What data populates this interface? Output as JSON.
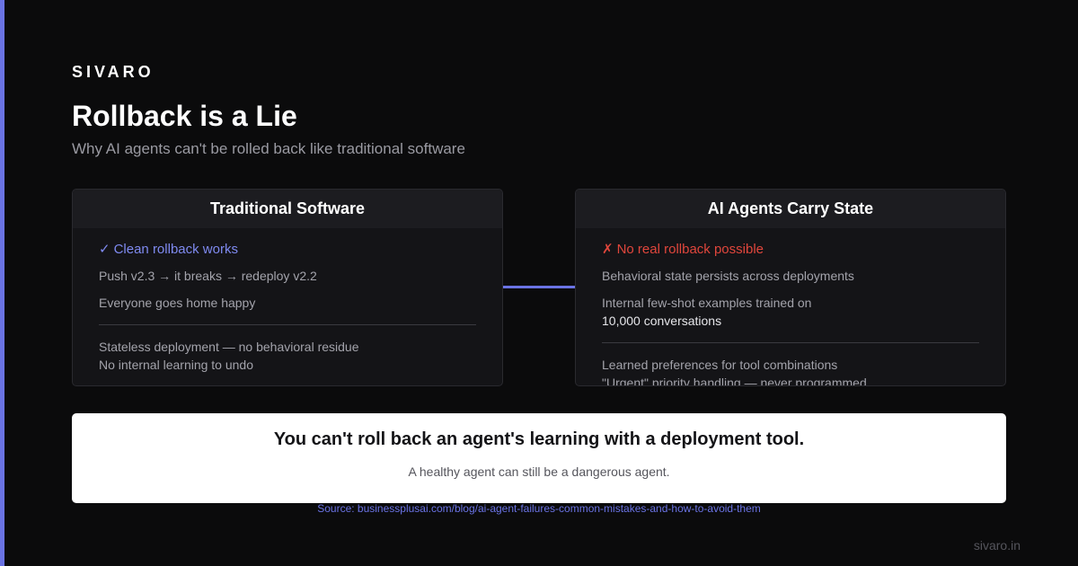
{
  "brand": "SIVARO",
  "title": "Rollback is a Lie",
  "subtitle": "Why AI agents can't be rolled back like traditional software",
  "colors": {
    "background": "#0b0b0c",
    "accent": "#6a73e4",
    "success": "#7f8af0",
    "danger": "#e0463c"
  },
  "cards": {
    "traditional": {
      "header": "Traditional Software",
      "status_icon": "✓",
      "status_text": "Clean rollback works",
      "lines": [
        "Push v2.3 → it breaks → redeploy v2.2",
        "Everyone goes home happy"
      ],
      "details": [
        "Stateless deployment — no behavioral residue",
        "No internal learning to undo"
      ]
    },
    "agents": {
      "header": "AI Agents Carry State",
      "status_icon": "✗",
      "status_text": "No real rollback possible",
      "lines": [
        "Behavioral state persists across deployments",
        "Internal few-shot examples trained on"
      ],
      "highlight": "10,000 conversations",
      "details": [
        "Learned preferences for tool combinations",
        "\"Urgent\" priority handling — never programmed"
      ]
    }
  },
  "callout": {
    "headline": "You can't roll back an agent's learning with a deployment tool.",
    "subline": "A healthy agent can still be a dangerous agent."
  },
  "source": {
    "label": "Source: businessplusai.com/blog/ai-agent-failures-common-mistakes-and-how-to-avoid-them"
  },
  "footer": "sivaro.in"
}
